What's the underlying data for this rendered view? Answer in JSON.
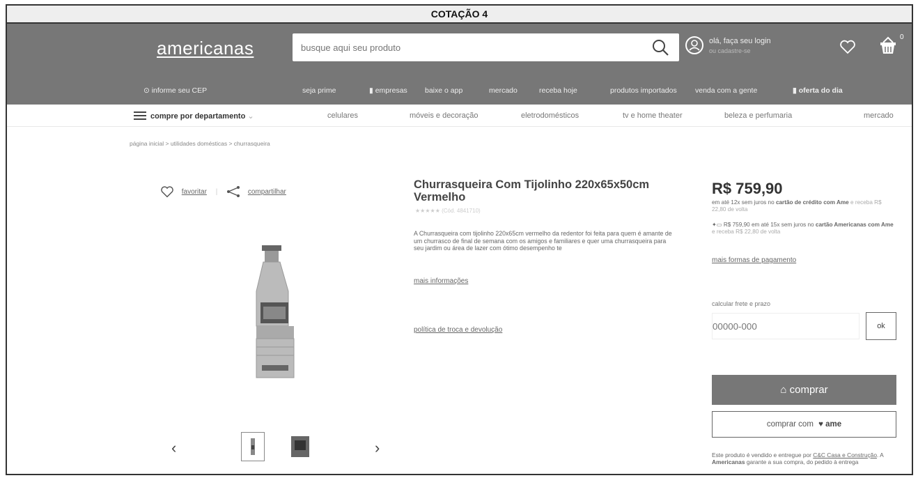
{
  "quote_title": "COTAÇÃO 4",
  "header": {
    "logo": "americanas",
    "search_placeholder": "busque aqui seu produto",
    "user_greeting": "olá, faça seu login",
    "user_sub": "ou cadastre-se",
    "basket_count": "0"
  },
  "subnav": {
    "cep": "informe seu CEP",
    "items": [
      "seja prime",
      "empresas",
      "baixe o app",
      "mercado",
      "receba hoje",
      "produtos importados",
      "venda com a gente",
      "oferta do dia"
    ]
  },
  "departments": {
    "main": "compre por departamento",
    "items": [
      "celulares",
      "móveis e decoração",
      "eletrodomésticos",
      "tv e home theater",
      "beleza e perfumaria",
      "mercado"
    ]
  },
  "breadcrumb": "página inicial  >  utilidades domésticas  >  churrasqueira",
  "gallery": {
    "favorite": "favoritar",
    "share": "compartilhar",
    "prev": "‹",
    "next": "›"
  },
  "product": {
    "title": "Churrasqueira Com Tijolinho 220x65x50cm Vermelho",
    "rating": "★★★★★  (Cód. 4841710)",
    "description": "A Churrasqueira com tijolinho 220x65cm vermelho da redentor foi feita para quem é amante de um churrasco de final de semana com os amigos e familiares e quer uma churrasqueira para seu jardim ou área de lazer com ótimo desempenho te",
    "more_info": "mais informações",
    "policy": "política de troca e devolução"
  },
  "pricing": {
    "price": "R$ 759,90",
    "installment_a": "em até 12x sem juros no",
    "installment_b": "cartão de crédito com Ame",
    "installment_c": "e receba R$ 22,80 de volta",
    "card_a": "R$ 759,90 em até 15x sem juros no",
    "card_b": "cartão Americanas com Ame",
    "card_c": "e receba R$ 22,80 de volta",
    "more_payments": "mais formas de pagamento",
    "freight_label": "calcular frete e prazo",
    "cep_placeholder": "00000-000",
    "ok": "ok",
    "buy": "comprar",
    "buy_ame": "comprar com",
    "ame_logo": "ame",
    "seller_a": "Este produto é vendido e entregue por",
    "seller_b": "C&C Casa e Construção",
    "seller_c": ". A",
    "seller_d": "Americanas",
    "seller_e": "garante a sua compra, do pedido à entrega"
  },
  "colors": {
    "header_bg": "#777777",
    "button_bg": "#777777"
  }
}
